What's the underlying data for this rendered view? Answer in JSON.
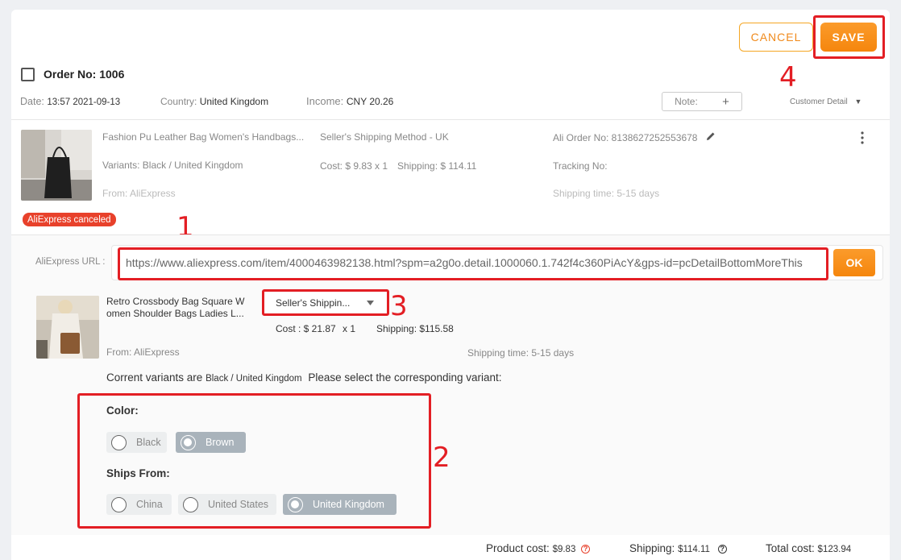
{
  "actions": {
    "cancel": "CANCEL",
    "save": "SAVE"
  },
  "order": {
    "order_no": "Order No: 1006",
    "date_label": "Date:",
    "date_value": "13:57 2021-09-13",
    "country_label": "Country:",
    "country_value": "United Kingdom",
    "income_label": "Income:",
    "income_value": "CNY 20.26",
    "note_label": "Note:",
    "note_plus": "+",
    "customer_detail": "Customer Detail",
    "caret": "▼"
  },
  "product": {
    "title": "Fashion Pu Leather Bag Women's Handbags...",
    "variants": "Variants: Black / United Kingdom",
    "from": "From: AliExpress",
    "shipping_method": "Seller's Shipping Method - UK",
    "cost": "Cost: $ 9.83 x 1",
    "shipping": "Shipping: $ 114.11",
    "ali_order_no": "Ali Order No: 8138627252553678",
    "tracking_no": "Tracking No:",
    "shipping_time": "Shipping time: 5-15 days",
    "status_badge": "AliExpress canceled"
  },
  "url_section": {
    "label": "AliExpress URL :",
    "url": "https://www.aliexpress.com/item/4000463982138.html?spm=a2g0o.detail.1000060.1.742f4c360PiAcY&gps-id=pcDetailBottomMoreThis",
    "ok": "OK"
  },
  "new_product": {
    "title_line1": "Retro Crossbody Bag Square W",
    "title_line2": "omen Shoulder Bags Ladies L...",
    "shipping_select": "Seller's Shippin...",
    "cost": "Cost : $ 21.87",
    "qty": "x 1",
    "shipping": "Shipping: $115.58",
    "from": "From: AliExpress",
    "shipping_time": "Shipping time: 5-15 days"
  },
  "variant_prompt": {
    "prefix": "Corrent variants are",
    "current": "Black / United Kingdom",
    "suffix": "Please select the corresponding variant:"
  },
  "color": {
    "label": "Color:",
    "options": [
      "Black",
      "Brown"
    ],
    "selected": "Brown"
  },
  "ships_from": {
    "label": "Ships From:",
    "options": [
      "China",
      "United States",
      "United Kingdom"
    ],
    "selected": "United Kingdom"
  },
  "annotations": {
    "n1": "1",
    "n2": "2",
    "n3": "3",
    "n4": "4"
  },
  "totals": {
    "product_cost_label": "Product cost:",
    "product_cost_value": "$9.83",
    "shipping_label": "Shipping:",
    "shipping_value": "$114.11",
    "total_label": "Total cost:",
    "total_value": "$123.94",
    "help": "?"
  },
  "colors": {
    "accent": "#f5860d",
    "annotation": "#e31e24",
    "badge": "#e8412b"
  }
}
